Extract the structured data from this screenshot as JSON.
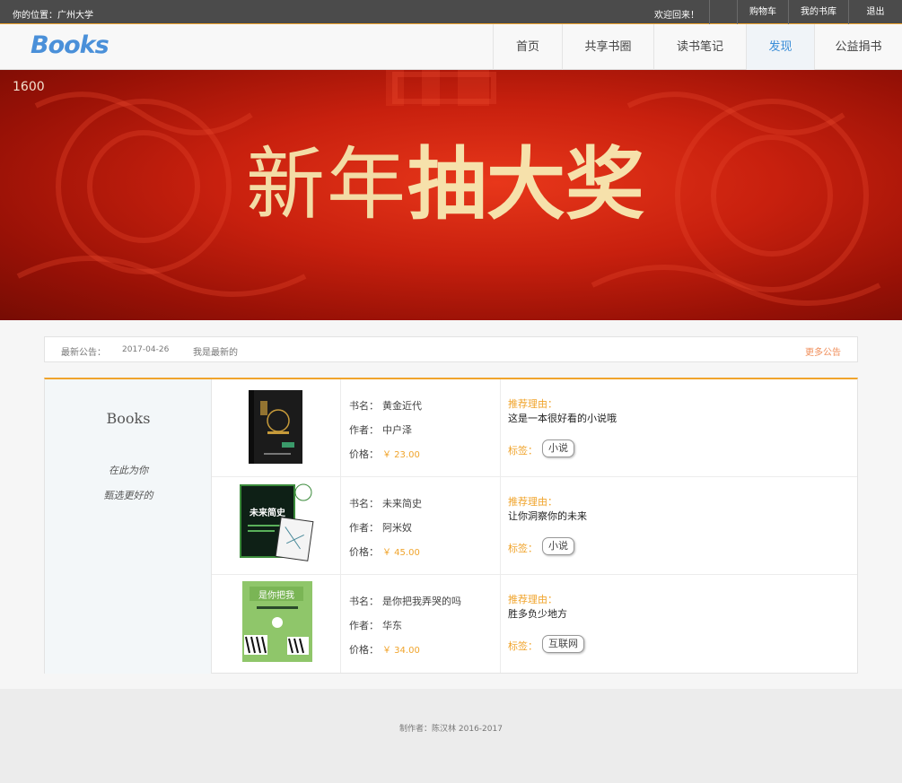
{
  "topbar": {
    "location": "你的位置：广州大学",
    "welcome": "欢迎回来！",
    "cart": "购物车",
    "shelf": "我的书库",
    "logout": "退出"
  },
  "nav": {
    "logo": "Books",
    "items": [
      "首页",
      "共享书圈",
      "读书笔记",
      "发现",
      "公益捐书"
    ],
    "active": "发现"
  },
  "banner": {
    "number": "1600",
    "title_light": "新年",
    "title_bold": "抽大奖"
  },
  "notice": {
    "label": "最新公告：",
    "date": "2017-04-26",
    "message": "我是最新的",
    "more": "更多公告"
  },
  "side": {
    "brand": "Books",
    "slogan1": "在此为你",
    "slogan2": "甄选更好的"
  },
  "labels": {
    "name": "书名：",
    "author": "作者：",
    "price": "价格：",
    "reason": "推荐理由：",
    "tag": "标签："
  },
  "books": [
    {
      "name": "黄金近代",
      "author": "中户泽",
      "price": "￥ 23.00",
      "reason": "这是一本很好看的小说哦",
      "tag": "小说"
    },
    {
      "name": "未来简史",
      "author": "阿米奴",
      "price": "￥ 45.00",
      "reason": "让你洞察你的未来",
      "tag": "小说"
    },
    {
      "name": "是你把我弄哭的吗",
      "author": "华东",
      "price": "￥ 34.00",
      "reason": "胜多负少地方",
      "tag": "互联网"
    }
  ],
  "footer": {
    "credit": "制作者：陈汉林 2016-2017"
  },
  "colors": {
    "accent": "#f0a42c",
    "link": "#3b8ed8",
    "banner": "#c8200e"
  }
}
